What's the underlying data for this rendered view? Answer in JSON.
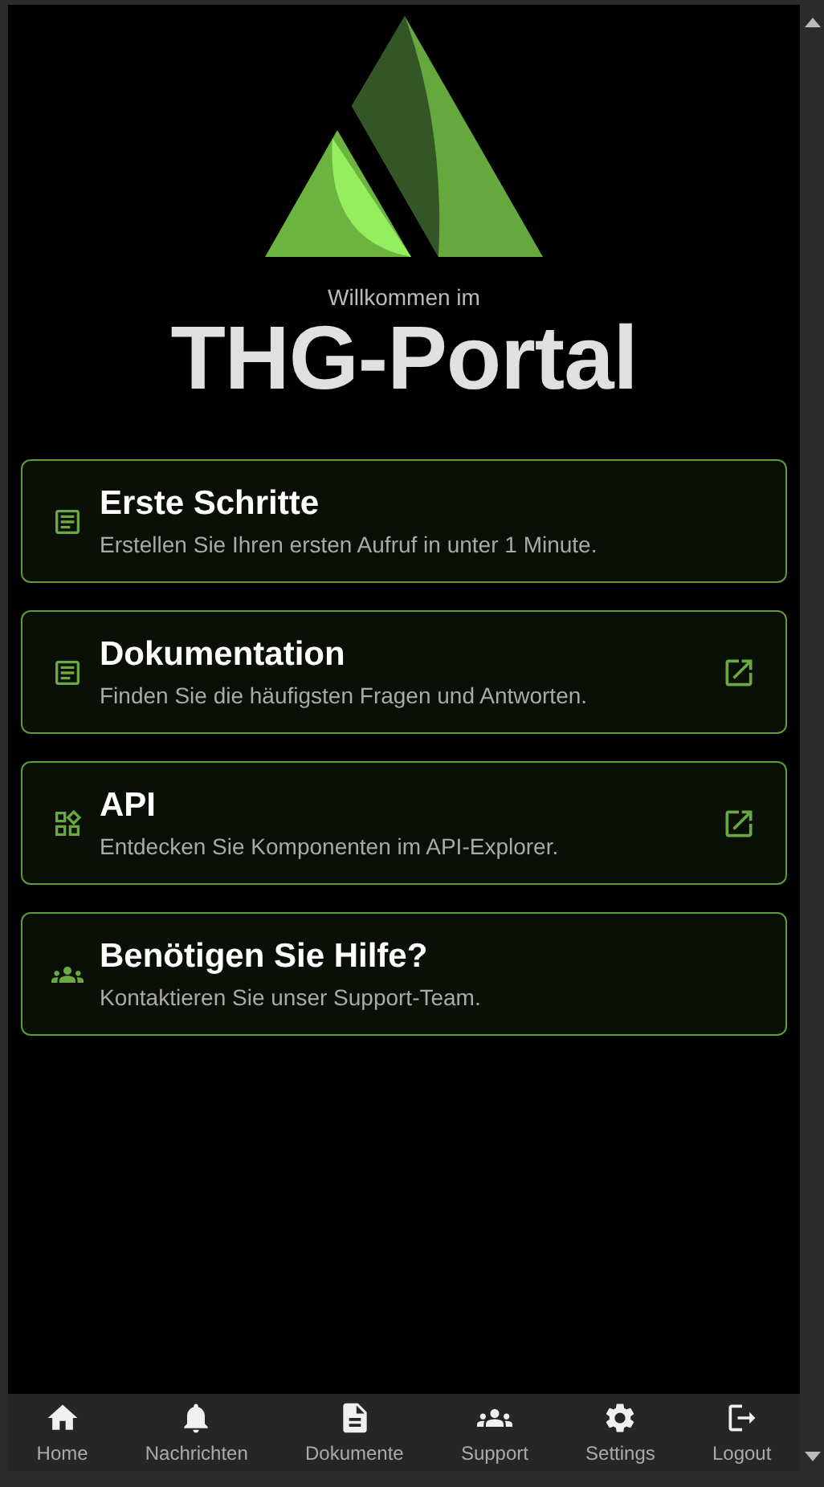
{
  "header": {
    "greeting": "Willkommen im",
    "title": "THG-Portal"
  },
  "cards": [
    {
      "kind": "article",
      "title": "Erste Schritte",
      "subtitle": "Erstellen Sie Ihren ersten Aufruf in unter 1 Minute.",
      "external": false
    },
    {
      "kind": "article",
      "title": "Dokumentation",
      "subtitle": "Finden Sie die häufigsten Fragen und Antworten.",
      "external": true
    },
    {
      "kind": "widgets",
      "title": "API",
      "subtitle": "Entdecken Sie Komponenten im API-Explorer.",
      "external": true
    },
    {
      "kind": "group",
      "title": "Benötigen Sie Hilfe?",
      "subtitle": "Kontaktieren Sie unser Support-Team.",
      "external": false
    }
  ],
  "bottom_nav": [
    {
      "kind": "home",
      "label": "Home"
    },
    {
      "kind": "bell",
      "label": "Nachrichten"
    },
    {
      "kind": "document",
      "label": "Dokumente"
    },
    {
      "kind": "group",
      "label": "Support"
    },
    {
      "kind": "gear",
      "label": "Settings"
    },
    {
      "kind": "logout",
      "label": "Logout"
    }
  ]
}
